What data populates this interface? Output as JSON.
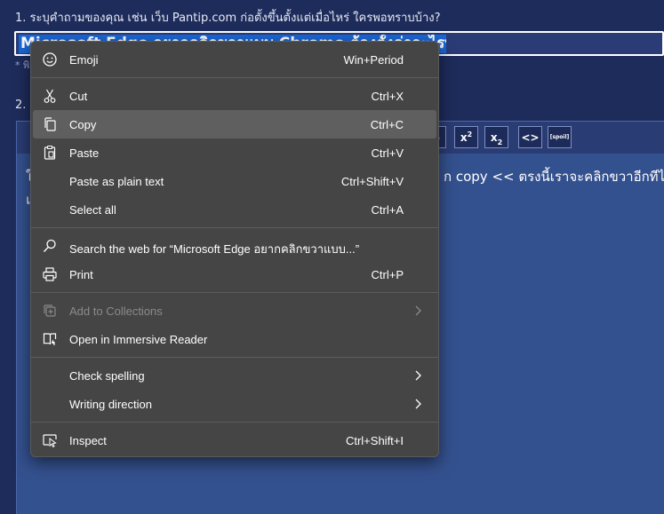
{
  "question1": {
    "label": "1. ระบุคำถามของคุณ เช่น เว็บ Pantip.com ก่อตั้งขึ้นตั้งแต่เมื่อไหร่ ใครพอทราบบ้าง?",
    "title_value": "Microsoft Edge อยากคลิกขวาแบบ Chrome ต้องตั้งค่าอะไรบ้างครับ",
    "hint": "* พิ"
  },
  "question2": {
    "label": "2. ร"
  },
  "toolbar": {
    "buttons": [
      {
        "icon": "strikethrough-icon",
        "text": "–"
      },
      {
        "icon": "superscript-icon",
        "text": "x",
        "mark": "2"
      },
      {
        "icon": "subscript-icon",
        "text": "x",
        "mark": "2"
      },
      {
        "icon": "code-icon",
        "text": "<>"
      },
      {
        "icon": "spoiler-icon",
        "text": "[spoil]"
      }
    ]
  },
  "editor": {
    "line1_lead": "ใ",
    "line1_tail": "ก copy << ตรงนี้เราจะคลิกขวาอีกทีได้",
    "line2": "แ"
  },
  "context_menu": {
    "items": [
      {
        "label": "Emoji",
        "shortcut": "Win+Period",
        "icon": "emoji-icon"
      },
      {
        "label": "Cut",
        "shortcut": "Ctrl+X",
        "icon": "cut-icon"
      },
      {
        "label": "Copy",
        "shortcut": "Ctrl+C",
        "icon": "copy-icon",
        "highlighted": true
      },
      {
        "label": "Paste",
        "shortcut": "Ctrl+V",
        "icon": "paste-icon"
      },
      {
        "label": "Paste as plain text",
        "shortcut": "Ctrl+Shift+V"
      },
      {
        "label": "Select all",
        "shortcut": "Ctrl+A"
      },
      {
        "label": "Search the web for “Microsoft Edge อยากคลิกขวาแบบ...”",
        "icon": "search-icon"
      },
      {
        "label": "Print",
        "shortcut": "Ctrl+P",
        "icon": "print-icon"
      },
      {
        "label": "Add to Collections",
        "icon": "collections-icon",
        "disabled": true,
        "submenu": true
      },
      {
        "label": "Open in Immersive Reader",
        "icon": "immersive-reader-icon"
      },
      {
        "label": "Check spelling",
        "submenu": true
      },
      {
        "label": "Writing direction",
        "submenu": true
      },
      {
        "label": "Inspect",
        "shortcut": "Ctrl+Shift+I",
        "icon": "inspect-icon"
      }
    ]
  },
  "colors": {
    "page_bg": "#1e2c5c",
    "menu_bg": "#454545",
    "menu_highlight": "#5f5f5f",
    "selection": "#1a67d6"
  }
}
